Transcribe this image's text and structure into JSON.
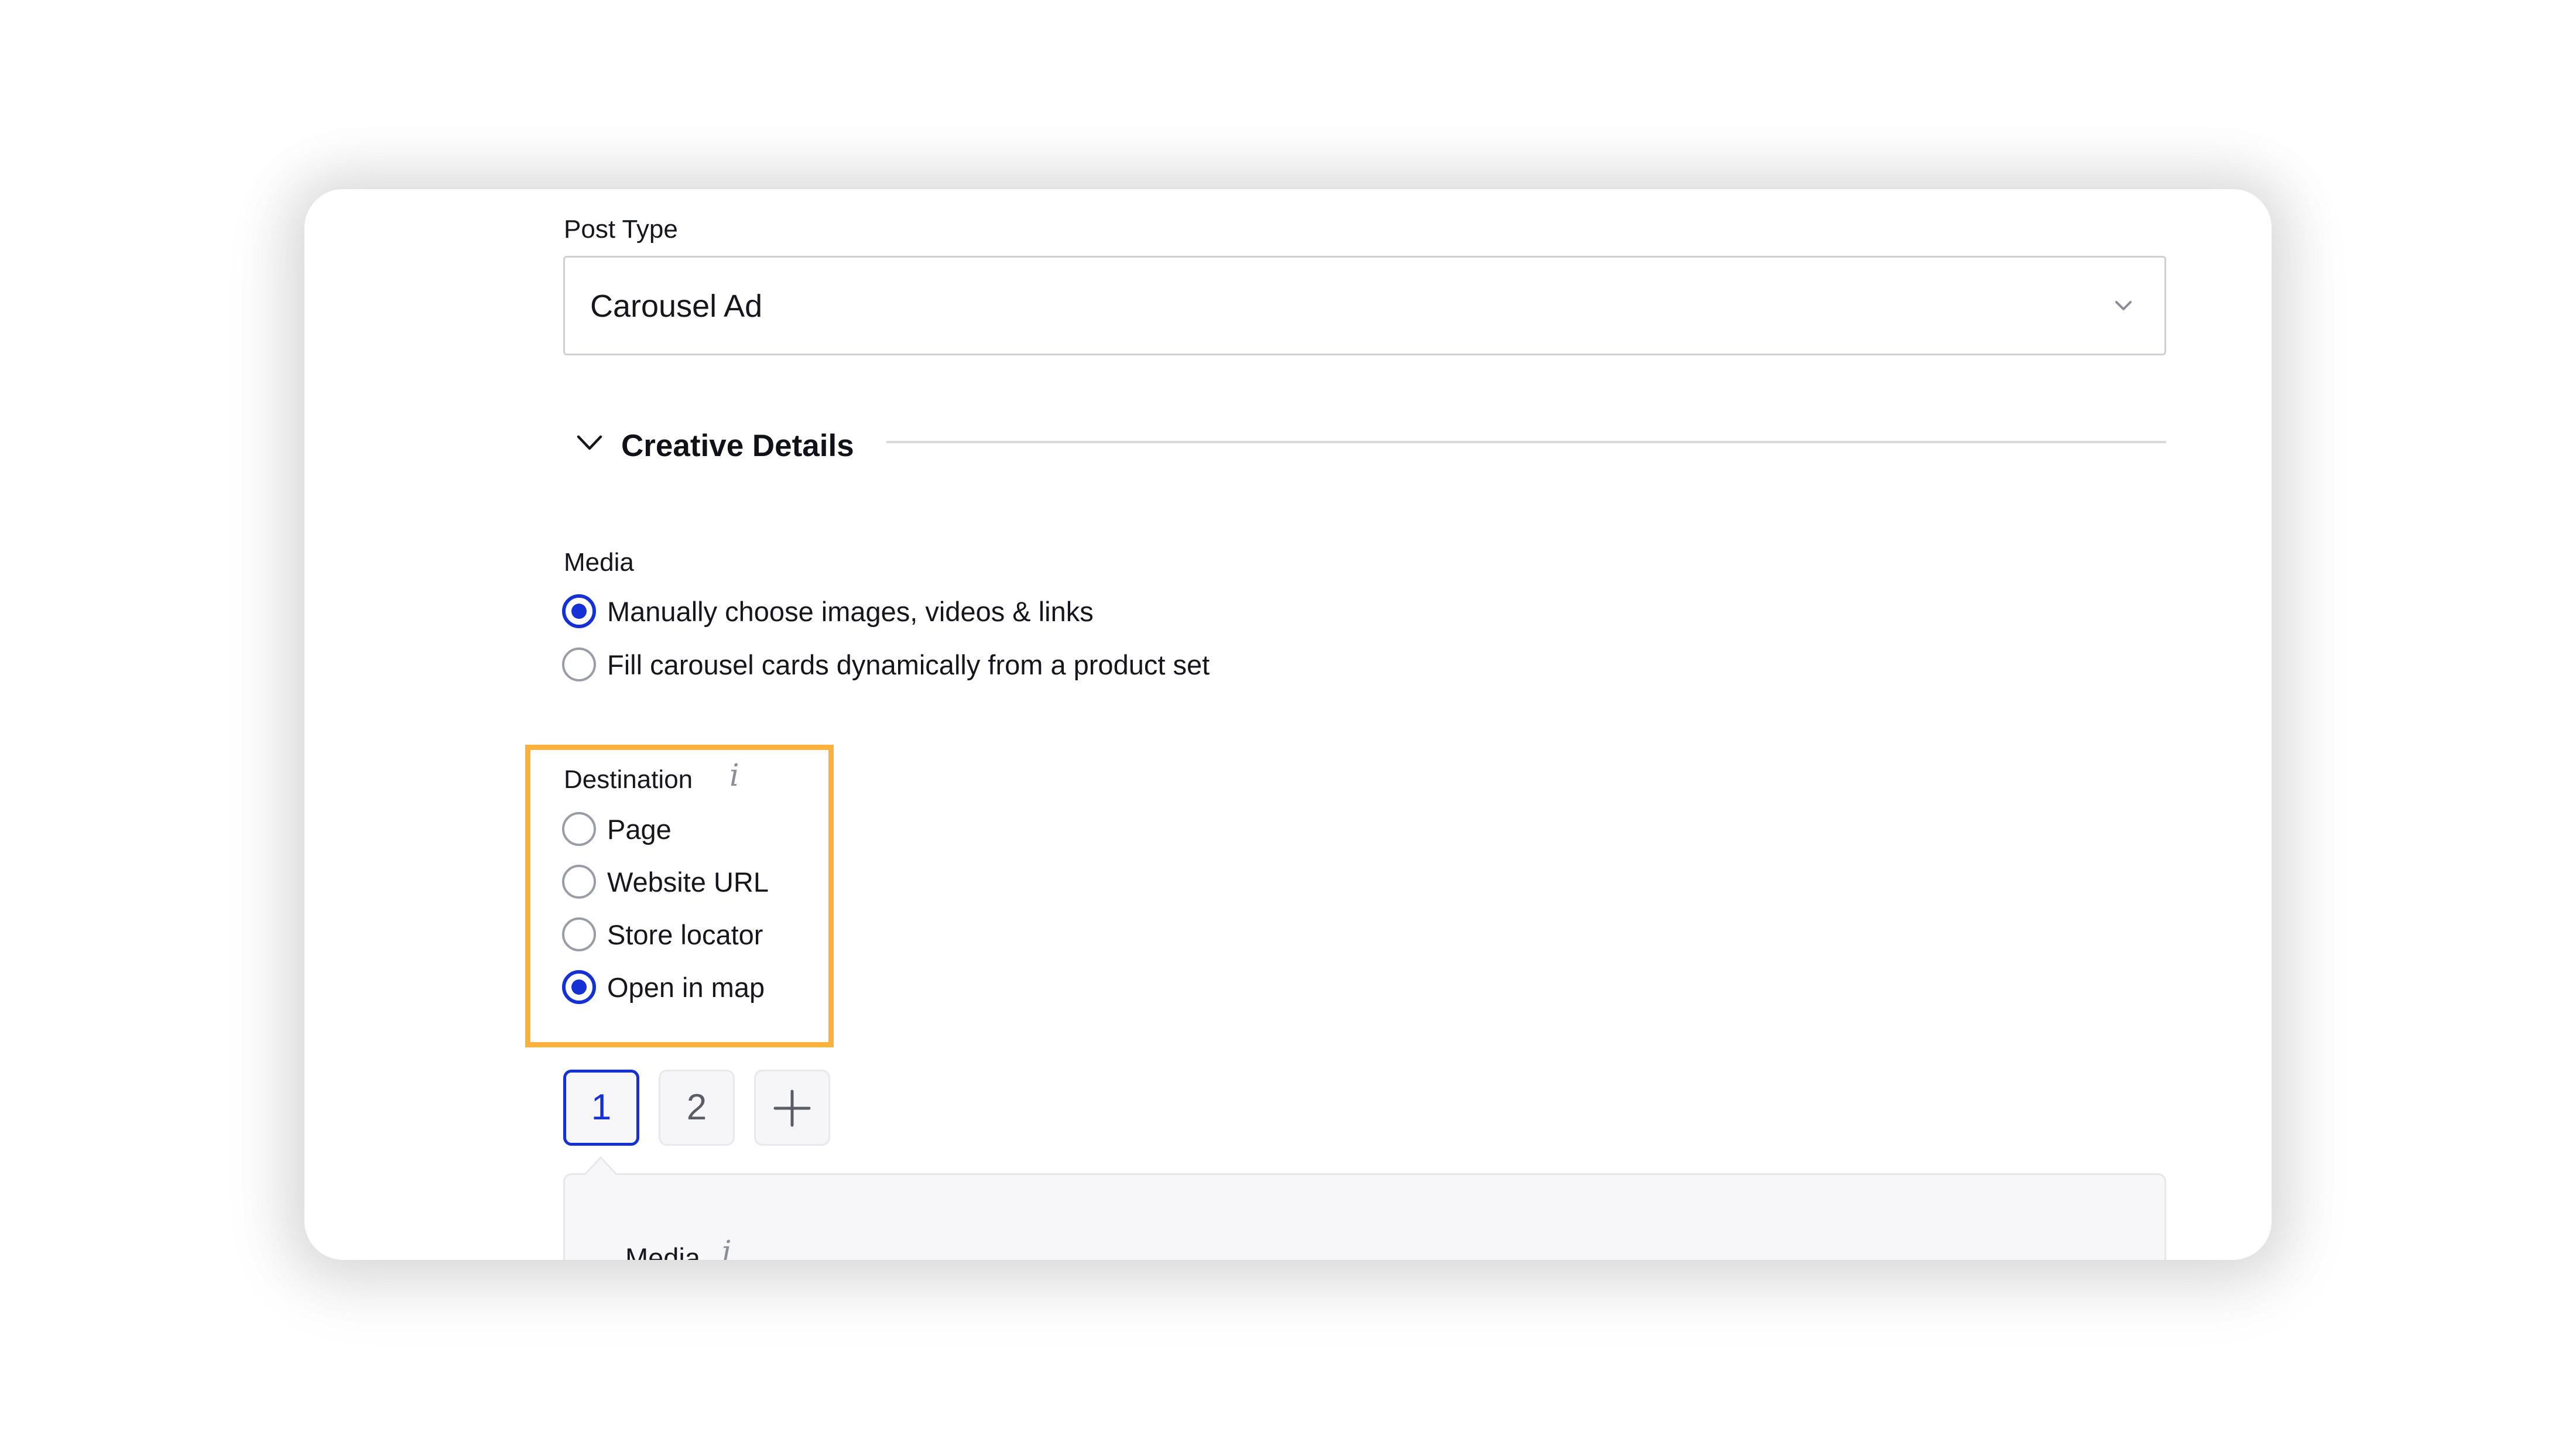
{
  "post_type": {
    "label": "Post Type",
    "selected_value": "Carousel Ad",
    "chevron_icon": "chevron-down-icon"
  },
  "creative_details": {
    "title": "Creative Details",
    "expanded": true,
    "chevron_icon": "chevron-down-icon"
  },
  "media": {
    "label": "Media",
    "options": [
      {
        "label": "Manually choose images, videos & links",
        "checked": true
      },
      {
        "label": "Fill carousel cards dynamically from a product set",
        "checked": false
      }
    ]
  },
  "destination": {
    "label": "Destination",
    "info_icon": "i",
    "options": [
      {
        "label": "Page",
        "checked": false
      },
      {
        "label": "Website URL",
        "checked": false
      },
      {
        "label": "Store locator",
        "checked": false
      },
      {
        "label": "Open in map",
        "checked": true
      }
    ]
  },
  "carousel_tabs": {
    "tabs": [
      "1",
      "2"
    ],
    "active_index": 0,
    "add_icon": "plus-icon"
  },
  "card": {
    "media_label": "Media",
    "info_icon": "i"
  },
  "colors": {
    "accent": "#1530d4",
    "highlight": "#fbb13c",
    "border": "#cfd0d6",
    "card_background": "#f7f7f9"
  }
}
